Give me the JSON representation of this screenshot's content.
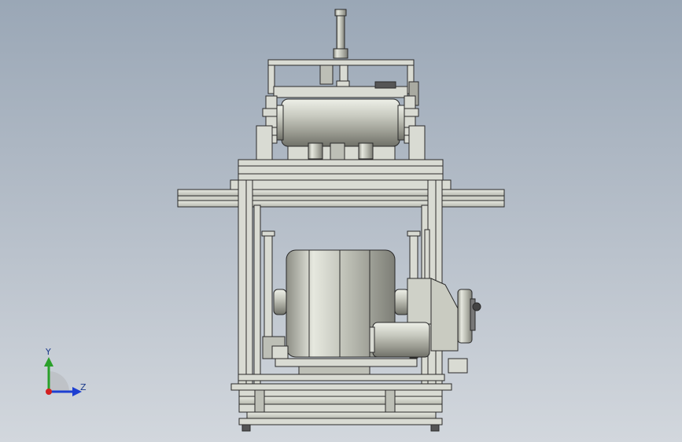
{
  "viewport": {
    "background_top": "#9aa7b6",
    "background_bottom": "#d2d7dd"
  },
  "model": {
    "part_fill": "#d9dbd3",
    "part_stroke": "#2a2a2a",
    "roller_dark": "#8f9086",
    "roller_light": "#eef0e8"
  },
  "triad": {
    "y_label": "Y",
    "z_label": "Z",
    "y_color": "#2aa02a",
    "z_color": "#1d3fd1",
    "origin_color": "#d22020"
  }
}
